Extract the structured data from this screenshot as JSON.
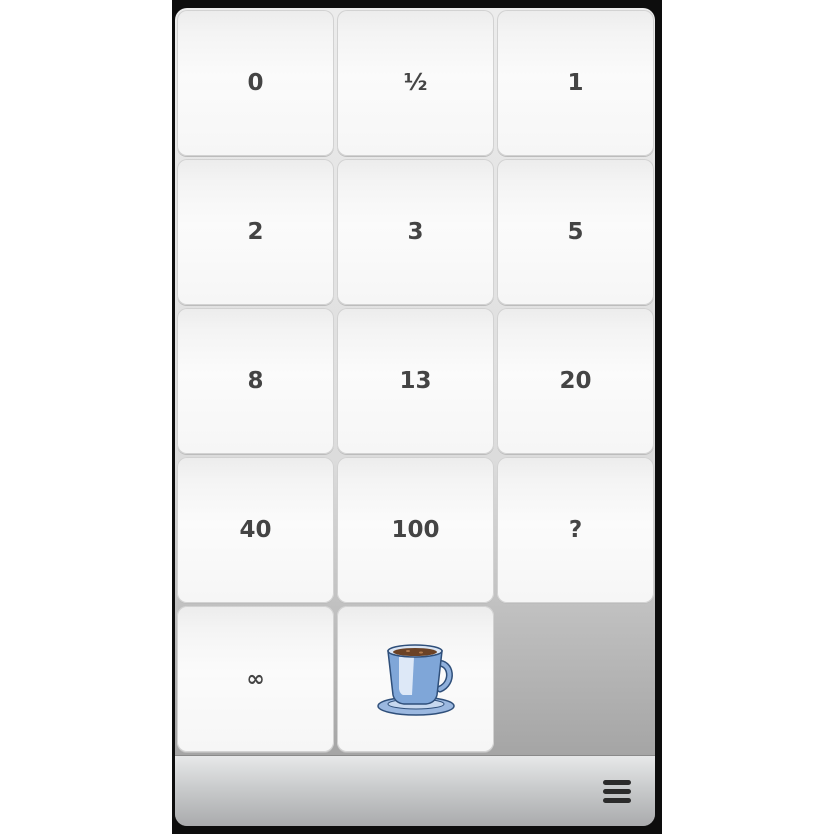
{
  "cards": [
    {
      "label": "0"
    },
    {
      "label": "½"
    },
    {
      "label": "1"
    },
    {
      "label": "2"
    },
    {
      "label": "3"
    },
    {
      "label": "5"
    },
    {
      "label": "8"
    },
    {
      "label": "13"
    },
    {
      "label": "20"
    },
    {
      "label": "40"
    },
    {
      "label": "100"
    },
    {
      "label": "?"
    },
    {
      "label": "∞"
    }
  ],
  "coffee_card": {
    "icon": "coffee-cup-icon"
  },
  "bottom_bar": {
    "menu_icon": "menu-icon"
  },
  "colors": {
    "card_text": "#444444",
    "frame": "#0d0d0d",
    "cup_blue": "#7fa6d8"
  }
}
